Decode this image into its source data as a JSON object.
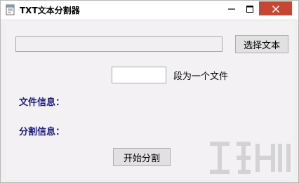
{
  "window": {
    "title": "TXT文本分割器"
  },
  "controls": {
    "path_value": "",
    "select_button": "选择文本",
    "count_value": "",
    "count_suffix": "段为一个文件",
    "file_info_label": "文件信息：",
    "split_info_label": "分割信息：",
    "start_button": "开始分割"
  },
  "colors": {
    "close_button": "#c7462f",
    "info_label": "#1a1a7e",
    "client_bg": "#f3f1f4"
  },
  "icons": {
    "app": "notepad-icon",
    "minimize": "minimize-icon",
    "maximize": "maximize-icon",
    "close": "close-icon"
  }
}
